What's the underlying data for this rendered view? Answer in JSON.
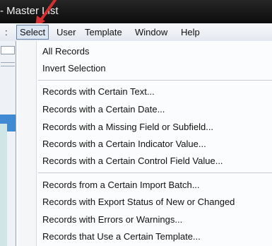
{
  "window": {
    "title": "- Master List"
  },
  "menubar": {
    "items": [
      {
        "label": ":"
      },
      {
        "label": "Select"
      },
      {
        "label": "User"
      },
      {
        "label": "Template"
      },
      {
        "label": "Window"
      },
      {
        "label": "Help"
      }
    ]
  },
  "select_menu": {
    "groups": [
      [
        {
          "label": "All Records"
        },
        {
          "label": "Invert Selection"
        }
      ],
      [
        {
          "label": "Records with Certain Text..."
        },
        {
          "label": "Records with a Certain Date..."
        },
        {
          "label": "Records with a Missing Field or Subfield..."
        },
        {
          "label": "Records with a Certain Indicator Value..."
        },
        {
          "label": "Records with a Certain Control Field Value..."
        }
      ],
      [
        {
          "label": "Records from a Certain Import Batch..."
        },
        {
          "label": "Records with Export Status of New or Changed"
        },
        {
          "label": "Records with Errors or Warnings..."
        },
        {
          "label": "Records that Use a Certain Template..."
        }
      ]
    ]
  },
  "colors": {
    "annotation_arrow": "#d62f2f",
    "active_menu_bg": "#dde7f4",
    "titlebar": "#141414"
  }
}
